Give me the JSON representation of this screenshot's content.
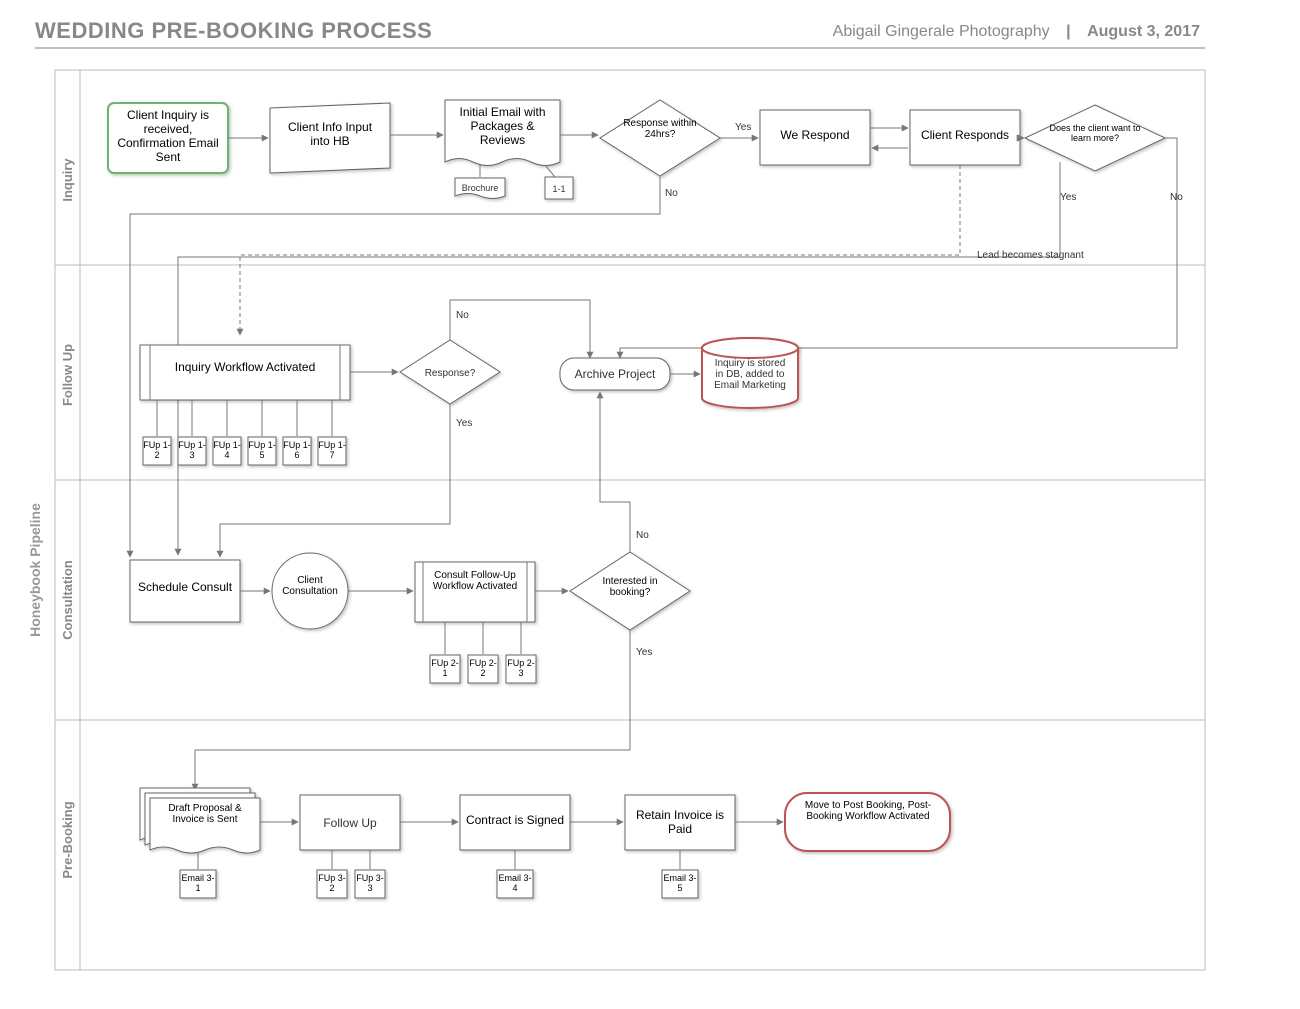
{
  "header": {
    "title": "WEDDING PRE-BOOKING PROCESS",
    "company": "Abigail Gingerale Photography",
    "separator": "|",
    "date": "August 3, 2017"
  },
  "pipeline_label": "Honeybook Pipeline",
  "lanes": {
    "inquiry": "Inquiry",
    "followup": "Follow Up",
    "consultation": "Consultation",
    "prebooking": "Pre-Booking"
  },
  "nodes": {
    "start": "Client Inquiry is received, Confirmation Email Sent",
    "input_hb": "Client Info Input into HB",
    "initial_email": "Initial Email with Packages & Reviews",
    "brochure": "Brochure",
    "one_one": "1-1",
    "response24": "Response within 24hrs?",
    "we_respond": "We Respond",
    "client_responds": "Client Responds",
    "learn_more": "Does the client want to learn more?",
    "inquiry_workflow": "Inquiry Workflow Activated",
    "response_q": "Response?",
    "archive": "Archive Project",
    "db_store": "Inquiry is stored in DB, added to Email Marketing",
    "schedule_consult": "Schedule Consult",
    "client_consultation": "Client Consultation",
    "consult_followup": "Consult Follow-Up Workflow Activated",
    "interested_booking": "Interested in booking?",
    "draft_proposal": "Draft Proposal & Invoice is Sent",
    "followup_box": "Follow Up",
    "contract_signed": "Contract is Signed",
    "retain_invoice": "Retain Invoice is Paid",
    "post_booking": "Move to Post Booking, Post-Booking Workflow Activated",
    "fup12": "FUp 1-2",
    "fup13": "FUp 1-3",
    "fup14": "FUp 1-4",
    "fup15": "FUp 1-5",
    "fup16": "FUp 1-6",
    "fup17": "FUp 1-7",
    "fup21": "FUp 2-1",
    "fup22": "FUp 2-2",
    "fup23": "FUp 2-3",
    "email31": "Email 3-1",
    "fup32": "FUp 3-2",
    "fup33": "FUp 3-3",
    "email34": "Email 3-4",
    "email35": "Email 3-5"
  },
  "labels": {
    "yes": "Yes",
    "no": "No",
    "stagnant": "Lead becomes stagnant"
  }
}
